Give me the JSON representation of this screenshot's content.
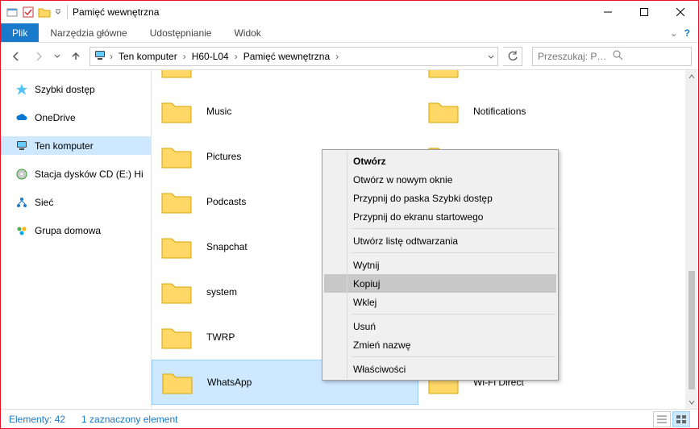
{
  "window": {
    "title": "Pamięć wewnętrzna"
  },
  "ribbon": {
    "file": "Plik",
    "home": "Narzędzia główne",
    "share": "Udostępnianie",
    "view": "Widok"
  },
  "breadcrumb": {
    "root": "Ten komputer",
    "level1": "H60-L04",
    "level2": "Pamięć wewnętrzna"
  },
  "search": {
    "placeholder": "Przeszukaj: Pamięć wewnętrz..."
  },
  "navpane": {
    "quick": "Szybki dostęp",
    "onedrive": "OneDrive",
    "thispc": "Ten komputer",
    "cd": "Stacja dysków CD (E:) Hi",
    "network": "Sieć",
    "homegroup": "Grupa domowa"
  },
  "folders": {
    "c0r0": "",
    "c1r0": "",
    "c0r1": "Music",
    "c1r1": "Notifications",
    "c0r2": "Pictures",
    "c1r2": "",
    "c0r3": "Podcasts",
    "c1r3": "",
    "c0r4": "Snapchat",
    "c1r4": "",
    "c0r5": "system",
    "c1r5": "",
    "c0r6": "TWRP",
    "c1r6": "",
    "c0r7": "WhatsApp",
    "c1r7": "Wi-Fi Direct"
  },
  "context_menu": {
    "open": "Otwórz",
    "open_new": "Otwórz w nowym oknie",
    "pin_quick": "Przypnij do paska Szybki dostęp",
    "pin_start": "Przypnij do ekranu startowego",
    "playlist": "Utwórz listę odtwarzania",
    "cut": "Wytnij",
    "copy": "Kopiuj",
    "paste": "Wklej",
    "delete": "Usuń",
    "rename": "Zmień nazwę",
    "properties": "Właściwości"
  },
  "status": {
    "count": "Elementy: 42",
    "selected": "1 zaznaczony element"
  }
}
